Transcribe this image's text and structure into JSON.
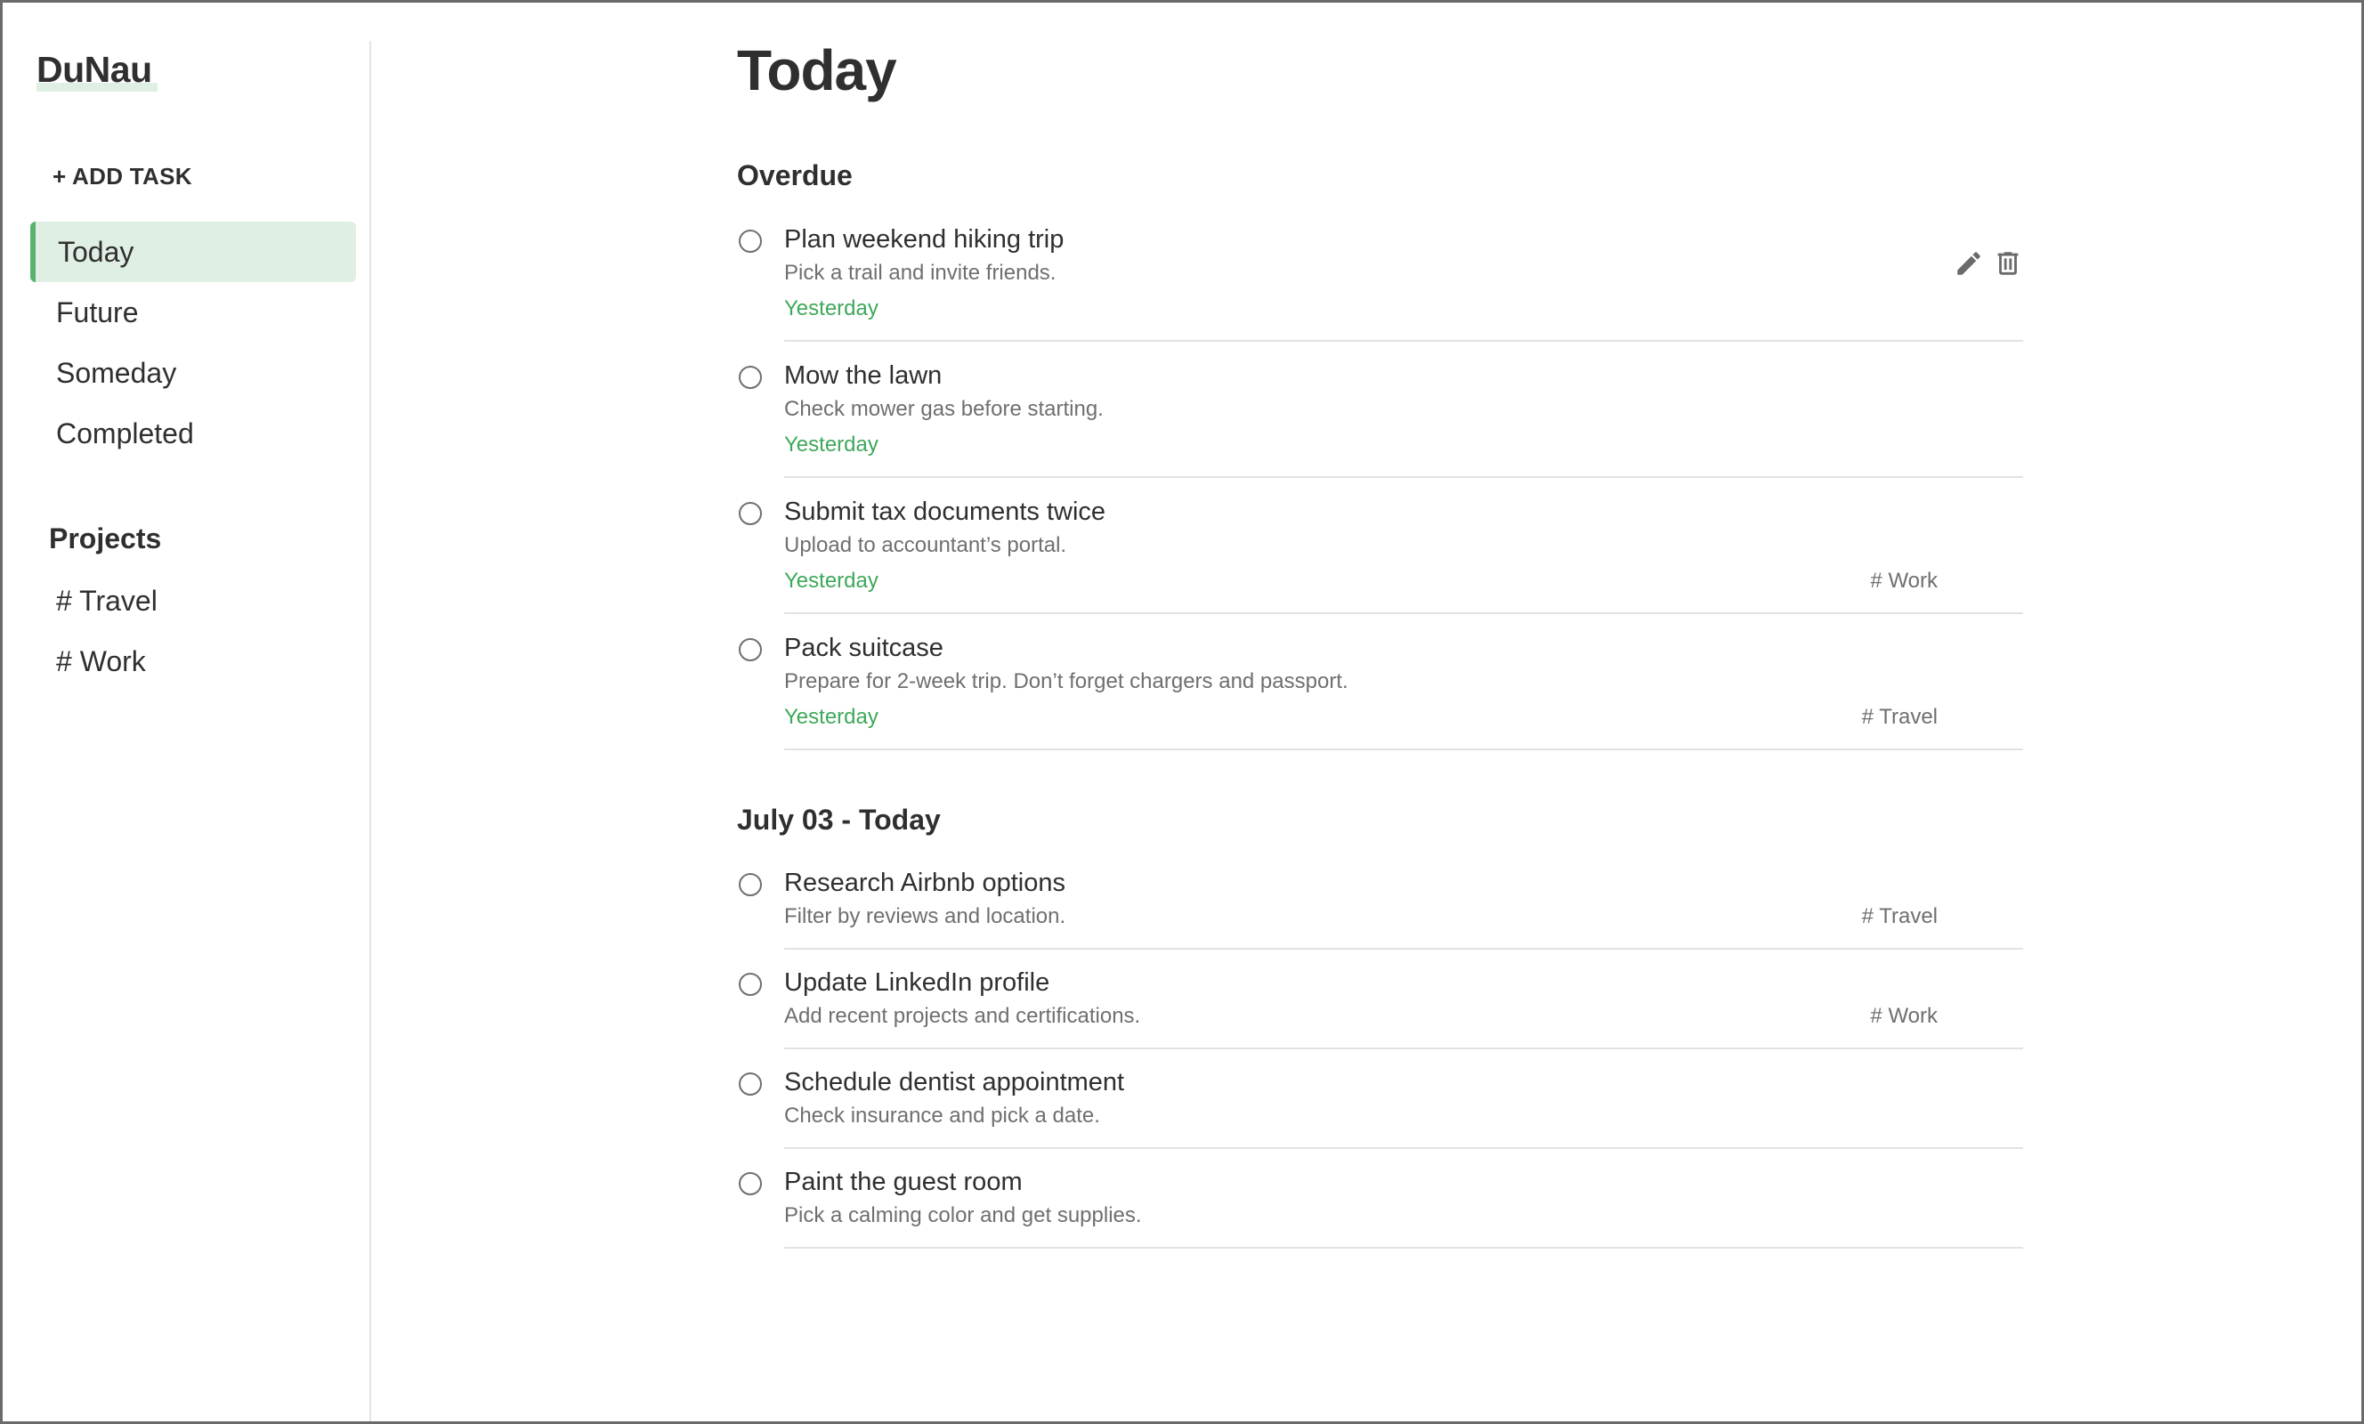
{
  "app": {
    "name": "DuNau"
  },
  "sidebar": {
    "add_task_label": "+ ADD TASK",
    "nav": [
      {
        "label": "Today",
        "active": true
      },
      {
        "label": "Future",
        "active": false
      },
      {
        "label": "Someday",
        "active": false
      },
      {
        "label": "Completed",
        "active": false
      }
    ],
    "projects_heading": "Projects",
    "projects": [
      {
        "label": "# Travel"
      },
      {
        "label": "# Work"
      }
    ]
  },
  "main": {
    "title": "Today",
    "sections": [
      {
        "heading": "Overdue",
        "tasks": [
          {
            "title": "Plan weekend hiking trip",
            "description": "Pick a trail and invite friends.",
            "due": "Yesterday",
            "tag": "",
            "hover_actions": [
              "pencil-icon",
              "trash-icon"
            ]
          },
          {
            "title": "Mow the lawn",
            "description": "Check mower gas before starting.",
            "due": "Yesterday",
            "tag": ""
          },
          {
            "title": "Submit tax documents twice",
            "description": "Upload to accountant’s portal.",
            "due": "Yesterday",
            "tag": "# Work"
          },
          {
            "title": "Pack suitcase",
            "description": "Prepare for 2-week trip. Don’t forget chargers and passport.",
            "due": "Yesterday",
            "tag": "# Travel"
          }
        ]
      },
      {
        "heading": "July 03 - Today",
        "tasks": [
          {
            "title": "Research Airbnb options",
            "description": "Filter by reviews and location.",
            "due": "",
            "tag": "# Travel"
          },
          {
            "title": "Update LinkedIn profile",
            "description": "Add recent projects and certifications.",
            "due": "",
            "tag": "# Work"
          },
          {
            "title": "Schedule dentist appointment",
            "description": "Check insurance and pick a date.",
            "due": "",
            "tag": ""
          },
          {
            "title": "Paint the guest room",
            "description": "Pick a calming color and get supplies.",
            "due": "",
            "tag": ""
          }
        ]
      }
    ]
  },
  "colors": {
    "accent_green": "#58b36c",
    "active_bg": "#e0efe3",
    "due_text": "#3fa85a",
    "muted_text": "#6f6f6f",
    "divider": "#e2e2e2"
  }
}
